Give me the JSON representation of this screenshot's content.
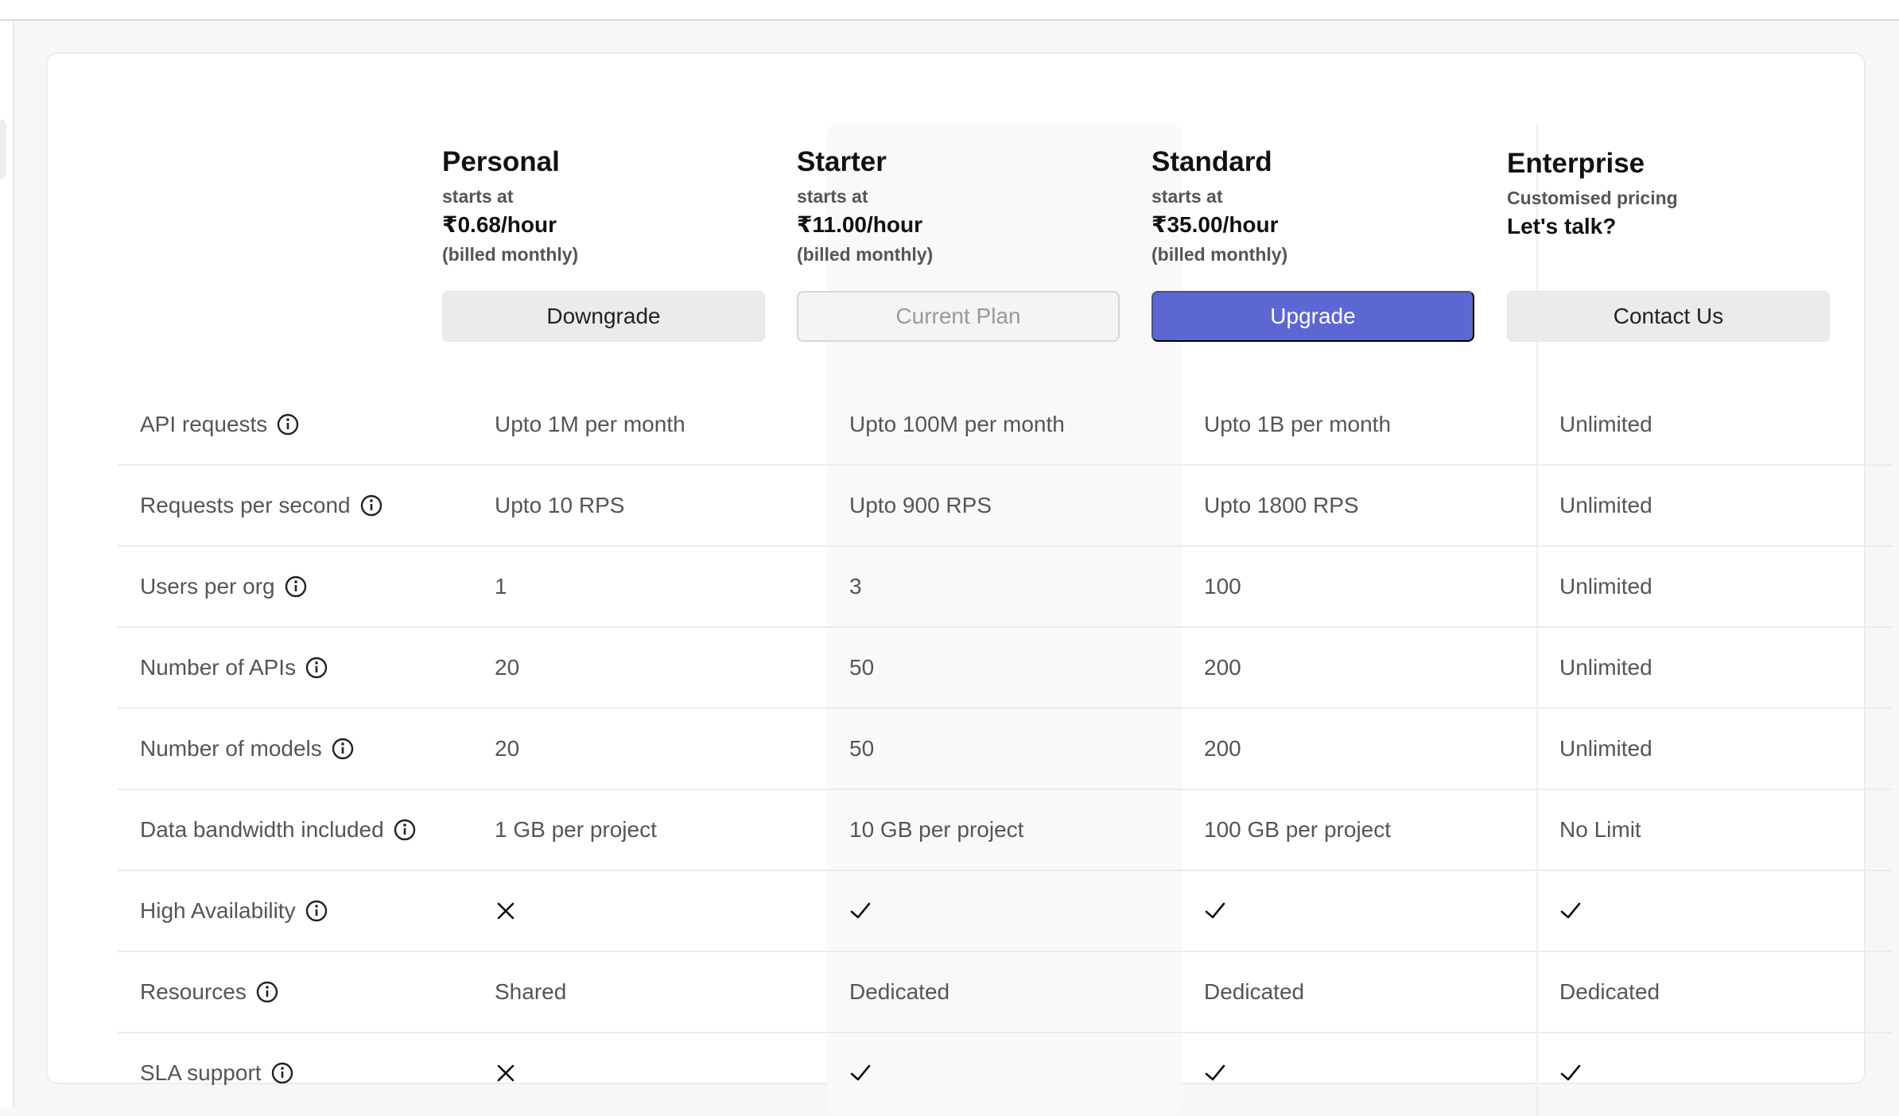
{
  "plans": [
    {
      "name": "Personal",
      "subtitle": "starts at",
      "price": "₹0.68/hour",
      "billing": "(billed monthly)",
      "button_label": "Downgrade"
    },
    {
      "name": "Starter",
      "subtitle": "starts at",
      "price": "₹11.00/hour",
      "billing": "(billed monthly)",
      "button_label": "Current Plan"
    },
    {
      "name": "Standard",
      "subtitle": "starts at",
      "price": "₹35.00/hour",
      "billing": "(billed monthly)",
      "button_label": "Upgrade"
    },
    {
      "name": "Enterprise",
      "subtitle": "Customised pricing",
      "price": "Let's talk?",
      "button_label": "Contact Us"
    }
  ],
  "rows": [
    {
      "feature": "API requests",
      "values": [
        "Upto 1M per month",
        "Upto 100M per month",
        "Upto 1B per month",
        "Unlimited"
      ]
    },
    {
      "feature": "Requests per second",
      "values": [
        "Upto 10 RPS",
        "Upto 900 RPS",
        "Upto 1800 RPS",
        "Unlimited"
      ]
    },
    {
      "feature": "Users per org",
      "values": [
        "1",
        "3",
        "100",
        "Unlimited"
      ]
    },
    {
      "feature": "Number of APIs",
      "values": [
        "20",
        "50",
        "200",
        "Unlimited"
      ]
    },
    {
      "feature": "Number of models",
      "values": [
        "20",
        "50",
        "200",
        "Unlimited"
      ]
    },
    {
      "feature": "Data bandwidth included",
      "values": [
        "1 GB per project",
        "10 GB per project",
        "100 GB per project",
        "No Limit"
      ]
    },
    {
      "feature": "High Availability",
      "icons": [
        "x-icon",
        "check-icon",
        "check-icon",
        "check-icon"
      ]
    },
    {
      "feature": "Resources",
      "values": [
        "Shared",
        "Dedicated",
        "Dedicated",
        "Dedicated"
      ]
    },
    {
      "feature": "SLA support",
      "icons": [
        "x-icon",
        "check-icon",
        "check-icon",
        "check-icon"
      ]
    }
  ],
  "colors": {
    "accent": "#5c67d4",
    "current_plan_column": "#f9f9f9"
  },
  "icons": {
    "feature_info": "info-icon",
    "included": "check-icon",
    "not_included": "x-icon"
  }
}
